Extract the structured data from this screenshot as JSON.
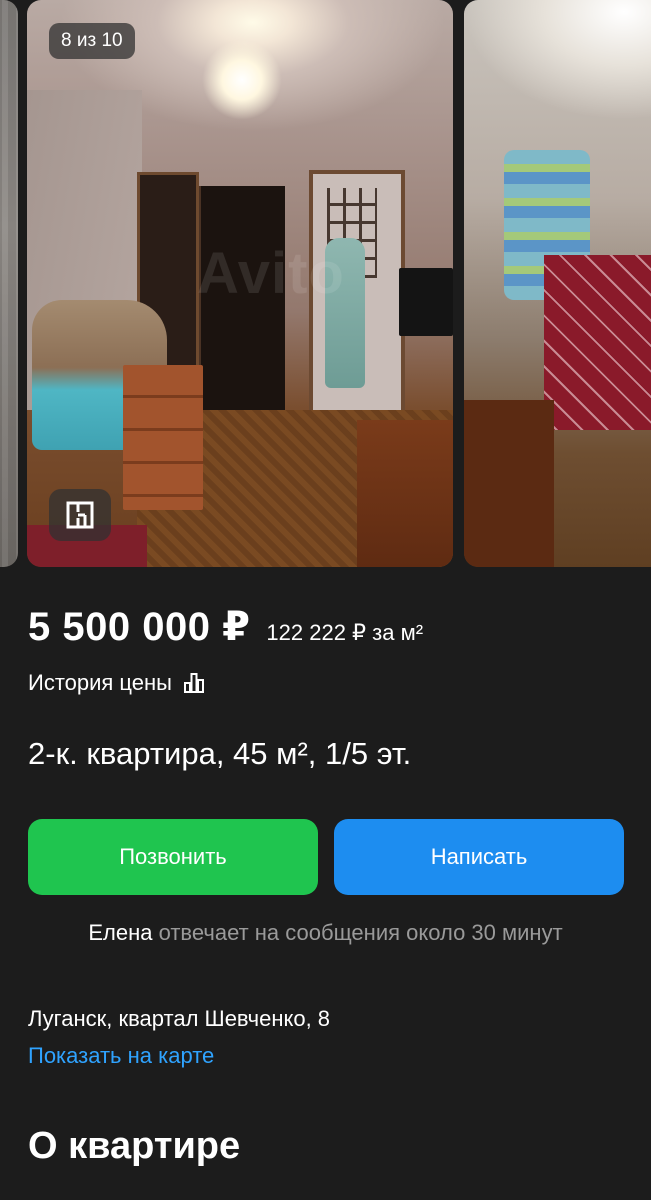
{
  "gallery": {
    "counter": "8 из 10",
    "watermark": "Avito"
  },
  "listing": {
    "price": "5 500 000 ₽",
    "price_per_m2": "122 222 ₽ за м²",
    "price_history_label": "История цены",
    "title": "2-к. квартира, 45 м², 1/5 эт."
  },
  "actions": {
    "call_label": "Позвонить",
    "write_label": "Написать",
    "call_color": "#1fc54f",
    "write_color": "#1d8df0"
  },
  "seller": {
    "name": "Елена",
    "response_text": " отвечает на сообщения около 30 минут"
  },
  "location": {
    "address": "Луганск, квартал Шевченко, 8",
    "map_link": "Показать на карте"
  },
  "sections": {
    "about": "О квартире"
  },
  "icons": {
    "floor_plan": "floor-plan-icon",
    "price_chart": "bar-chart-icon"
  }
}
